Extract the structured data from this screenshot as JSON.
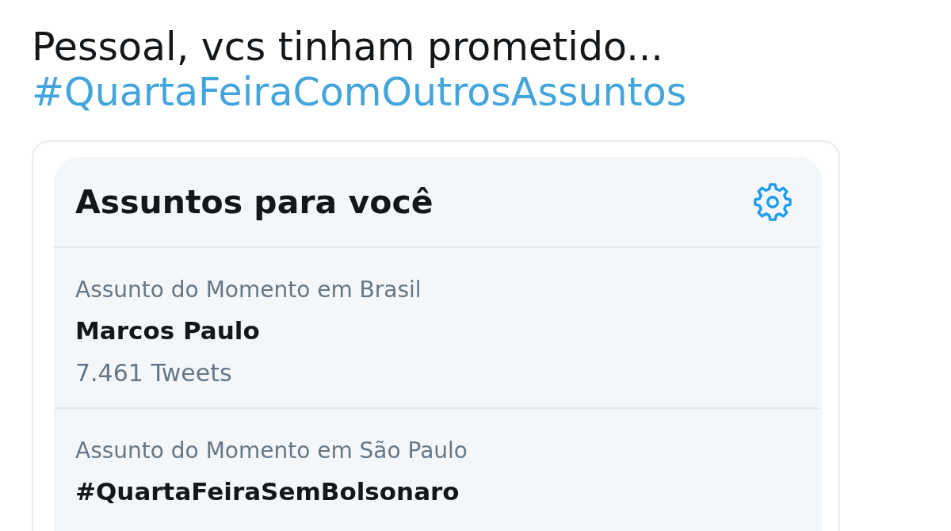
{
  "tweet": {
    "text": "Pessoal, vcs tinham prometido...",
    "hashtag": "#QuartaFeiraComOutrosAssuntos"
  },
  "trends_panel": {
    "title": "Assuntos para você",
    "items": [
      {
        "context": "Assunto do Momento em Brasil",
        "name": "Marcos Paulo",
        "count": "7.461 Tweets"
      },
      {
        "context": "Assunto do Momento em São Paulo",
        "name": "#QuartaFeiraSemBolsonaro"
      }
    ]
  }
}
